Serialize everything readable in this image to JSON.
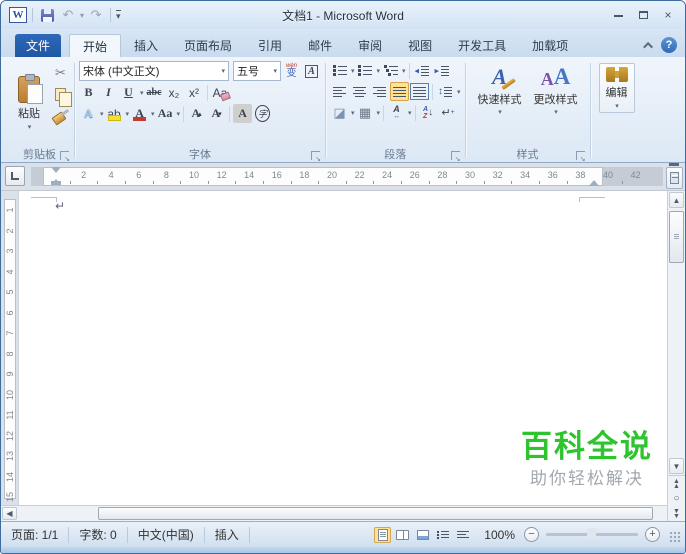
{
  "colors": {
    "accent_blue": "#2d69b8",
    "watermark_green": "#2dc42d",
    "highlight_active": "#fde398"
  },
  "titlebar": {
    "logo": "W",
    "title": "文档1 - Microsoft Word"
  },
  "tabs": {
    "file": "文件",
    "active": "开始",
    "items": [
      "开始",
      "插入",
      "页面布局",
      "引用",
      "邮件",
      "审阅",
      "视图",
      "开发工具",
      "加载项"
    ],
    "help": "?"
  },
  "ribbon": {
    "clipboard": {
      "label": "剪贴板",
      "paste": "粘贴"
    },
    "font": {
      "label": "字体",
      "name": "宋体 (中文正文)",
      "size": "五号",
      "bold": "B",
      "italic": "I",
      "underline": "U",
      "strike": "abc",
      "subscript": "x₂",
      "superscript": "x²",
      "clear": "Aa",
      "effects": "A",
      "highlight": "ab",
      "color": "A",
      "case": "Aa",
      "grow": "A",
      "shrink": "A",
      "shading": "A",
      "enclose": "字",
      "phonetic_top": "wén",
      "phonetic_bottom": "变",
      "border": "A"
    },
    "paragraph": {
      "label": "段落",
      "sort_a": "A",
      "sort_z": "Z",
      "sort_arrow": "↓",
      "mark": "↵"
    },
    "styles": {
      "label": "样式",
      "quick": "快速样式",
      "change": "更改样式",
      "quick_icon": "A",
      "change_icon_a": "A",
      "change_icon_b": "A"
    },
    "editing": {
      "label": "编辑"
    }
  },
  "ruler": {
    "h_numbers": [
      2,
      4,
      6,
      8,
      10,
      12,
      14,
      16,
      18,
      20,
      22,
      24,
      26,
      28,
      30,
      32,
      34,
      36,
      38,
      40,
      42
    ],
    "v_numbers": [
      1,
      2,
      3,
      4,
      5,
      6,
      7,
      8,
      9,
      10,
      11,
      12,
      13,
      14,
      15
    ]
  },
  "document": {
    "paragraph_mark": "↵"
  },
  "watermark": {
    "title": "百科全说",
    "subtitle": "助你轻松解决"
  },
  "statusbar": {
    "page": "页面: 1/1",
    "words": "字数: 0",
    "language": "中文(中国)",
    "mode": "插入",
    "zoom": "100%"
  }
}
